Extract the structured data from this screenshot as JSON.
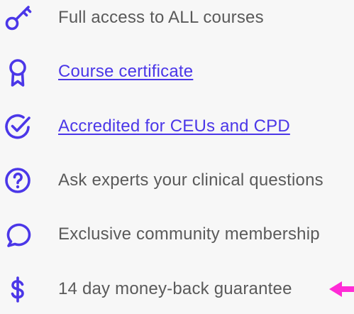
{
  "accent_color": "#4b37e8",
  "text_color": "#5a5a5a",
  "arrow_color": "#ff2bd6",
  "features": [
    {
      "icon": "key-icon",
      "label": "Full access to ALL courses",
      "link": false
    },
    {
      "icon": "award-ribbon-icon",
      "label": "Course certificate",
      "link": true
    },
    {
      "icon": "check-circle-icon",
      "label": "Accredited for CEUs and CPD",
      "link": true
    },
    {
      "icon": "question-circle-icon",
      "label": "Ask experts your clinical questions",
      "link": false
    },
    {
      "icon": "chat-bubble-icon",
      "label": "Exclusive community membership",
      "link": false
    },
    {
      "icon": "dollar-sign-icon",
      "label": "14 day money-back guarantee",
      "link": false
    }
  ]
}
